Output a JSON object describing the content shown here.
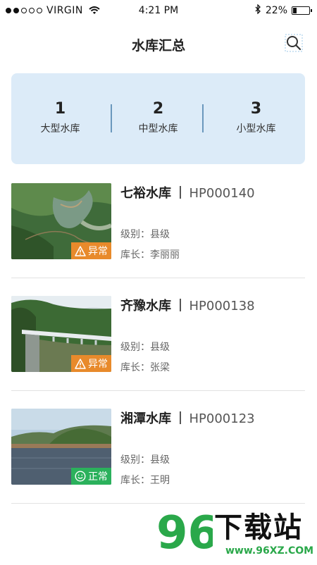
{
  "status_bar": {
    "carrier": "VIRGIN",
    "time": "4:21 PM",
    "battery": "22%",
    "battery_level": 0.22
  },
  "nav": {
    "title": "水库汇总",
    "search_icon": "search-icon"
  },
  "summary": [
    {
      "count": "1",
      "label": "大型水库"
    },
    {
      "count": "2",
      "label": "中型水库"
    },
    {
      "count": "3",
      "label": "小型水库"
    }
  ],
  "reservoirs": [
    {
      "name": "七裕水库",
      "code": "HP000140",
      "level": "级别：县级",
      "manager": "库长：李丽丽",
      "status": "异常",
      "status_type": "warning",
      "status_color": "#e88a2b"
    },
    {
      "name": "齐豫水库",
      "code": "HP000138",
      "level": "级别：县级",
      "manager": "库长：张梁",
      "status": "异常",
      "status_type": "warning",
      "status_color": "#e88a2b"
    },
    {
      "name": "湘潭水库",
      "code": "HP000123",
      "level": "级别：县级",
      "manager": "库长：王明",
      "status": "正常",
      "status_type": "normal",
      "status_color": "#2bb15c"
    }
  ],
  "watermark": {
    "logo": "96",
    "text": "下载站",
    "url": "www.96XZ.COM"
  }
}
